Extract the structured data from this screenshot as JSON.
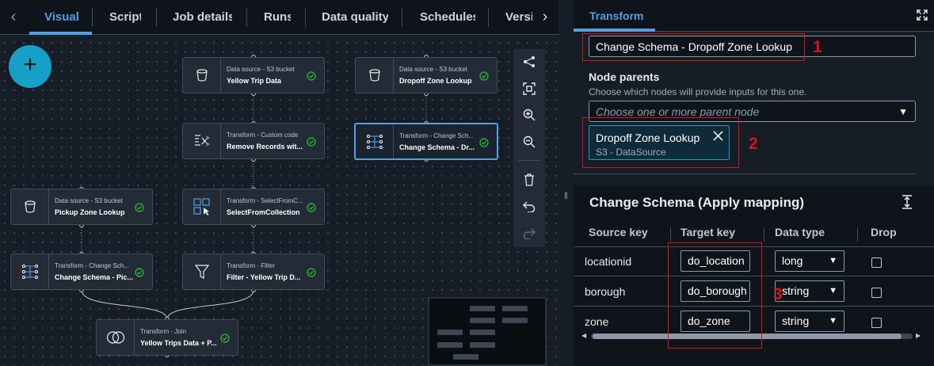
{
  "top_tabs": [
    {
      "label": "Visual"
    },
    {
      "label": "Script"
    },
    {
      "label": "Job details"
    },
    {
      "label": "Runs"
    },
    {
      "label": "Data quality"
    },
    {
      "label": "Schedules"
    },
    {
      "label": "Versi"
    }
  ],
  "active_tab": "Visual",
  "add_button": {
    "label": "+"
  },
  "nodes": [
    {
      "type": "Data source - S3 bucket",
      "name": "Yellow Trip Data",
      "icon": "bucket-icon"
    },
    {
      "type": "Data source - S3 bucket",
      "name": "Dropoff Zone Lookup",
      "icon": "bucket-icon"
    },
    {
      "type": "Transform - Custom code",
      "name": "Remove Records wit...",
      "icon": "custom-code-icon"
    },
    {
      "type": "Transform - Change Sch...",
      "name": "Change Schema - Dr...",
      "icon": "apply-mapping-icon",
      "selected": true
    },
    {
      "type": "Data source - S3 bucket",
      "name": "Pickup Zone Lookup",
      "icon": "bucket-icon"
    },
    {
      "type": "Transform - SelectFromC...",
      "name": "SelectFromCollection",
      "icon": "select-collection-icon"
    },
    {
      "type": "Transform - Change Sch...",
      "name": "Change Schema - Pic...",
      "icon": "apply-mapping-icon"
    },
    {
      "type": "Transform - Filter",
      "name": "Filter - Yellow Trip D...",
      "icon": "filter-icon"
    },
    {
      "type": "Transform - Join",
      "name": "Yellow Trips Data + P...",
      "icon": "join-icon"
    }
  ],
  "toolbar_icons": [
    "layout-icon",
    "fit-screen-icon",
    "zoom-in-icon",
    "zoom-out-icon",
    "delete-icon",
    "undo-icon",
    "redo-icon"
  ],
  "panel": {
    "tab": "Transform",
    "node_name": "Change Schema - Dropoff Zone Lookup",
    "node_parents_label": "Node parents",
    "node_parents_desc": "Choose which nodes will provide inputs for this one.",
    "node_parents_placeholder": "Choose one or more parent node",
    "parent_token": {
      "title": "Dropoff Zone Lookup",
      "subtitle": "S3 - DataSource"
    },
    "section_title": "Change Schema (Apply mapping)",
    "columns": [
      "Source key",
      "Target key",
      "Data type",
      "Drop"
    ],
    "rows": [
      {
        "source": "locationid",
        "target": "do_location",
        "type": "long",
        "drop": false
      },
      {
        "source": "borough",
        "target": "do_borough",
        "type": "string",
        "drop": false
      },
      {
        "source": "zone",
        "target": "do_zone",
        "type": "string",
        "drop": false
      }
    ]
  },
  "annotations": [
    "1",
    "2",
    "3"
  ],
  "colors": {
    "accent": "#539fe5",
    "success": "#29ad32",
    "annotation": "#d91515",
    "fab": "#16a0c8"
  }
}
